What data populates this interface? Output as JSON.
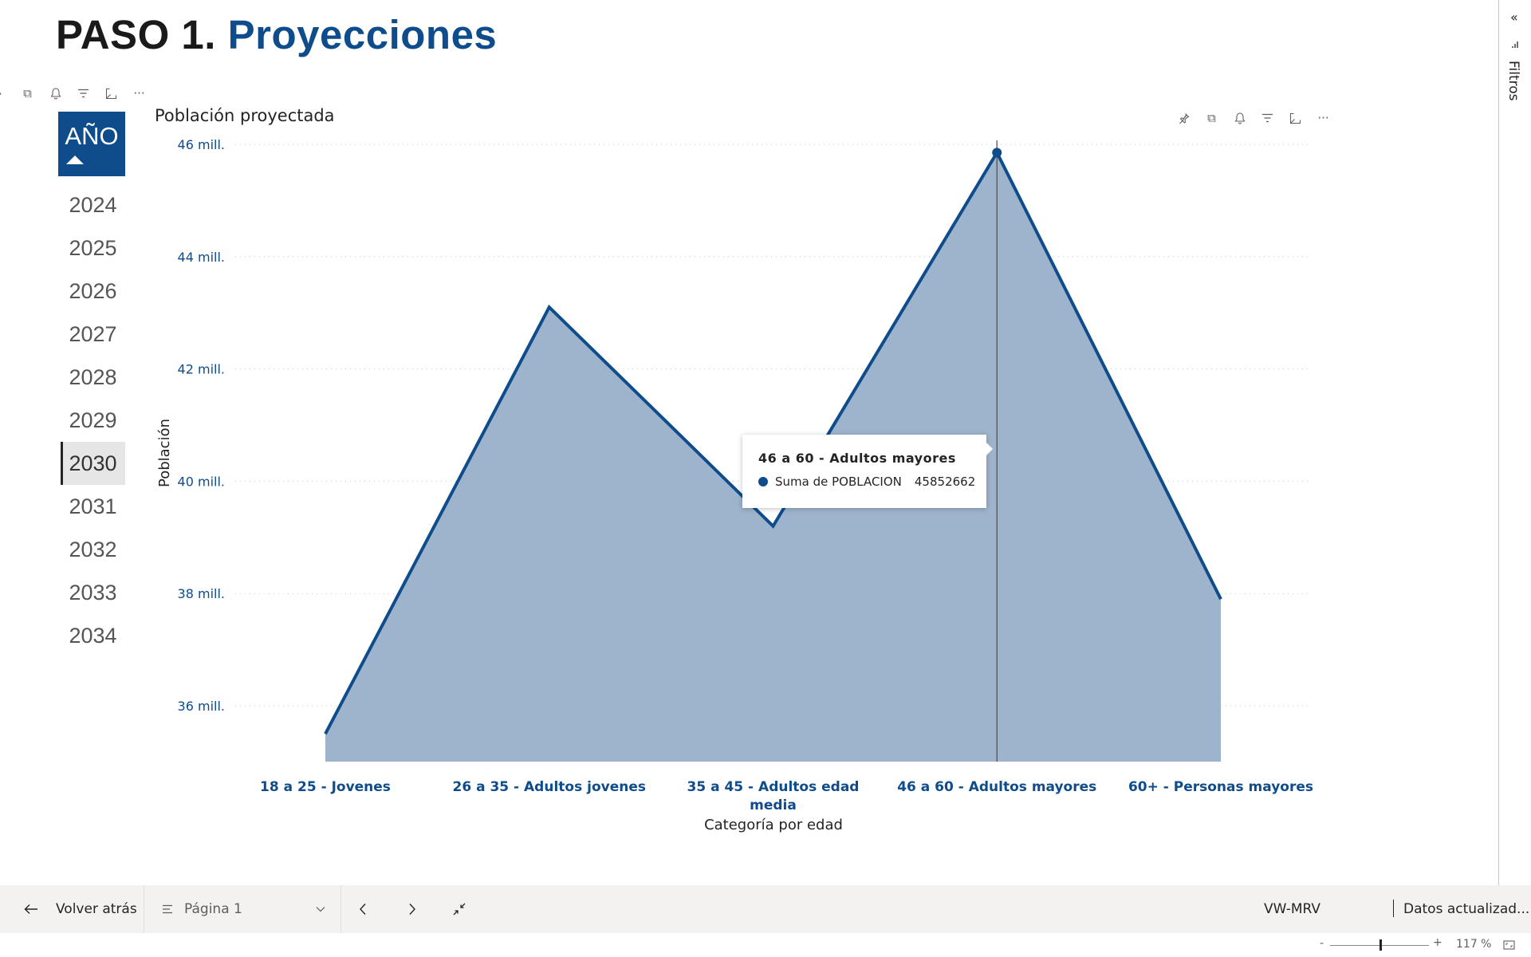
{
  "page_title": {
    "step": "PASO 1.",
    "accent": "Proyecciones"
  },
  "slicer": {
    "header": "AÑO",
    "items": [
      "2024",
      "2025",
      "2026",
      "2027",
      "2028",
      "2029",
      "2030",
      "2031",
      "2032",
      "2033",
      "2034"
    ],
    "selected": "2030"
  },
  "chart_title": "Población proyectada",
  "chart_data": {
    "type": "area",
    "x": [
      "18 a 25 - Jovenes",
      "26 a 35 - Adultos jovenes",
      "35 a 45 - Adultos edad media",
      "46 a 60 - Adultos mayores",
      "60+ - Personas mayores"
    ],
    "x_display": [
      [
        "18 a 25 - Jovenes"
      ],
      [
        "26 a 35 - Adultos jovenes"
      ],
      [
        "35 a 45 - Adultos edad",
        "media"
      ],
      [
        "46 a 60 - Adultos mayores"
      ],
      [
        "60+ - Personas mayores"
      ]
    ],
    "series": [
      {
        "values": [
          35500000,
          43100000,
          39200000,
          45852662,
          37900000
        ]
      }
    ],
    "yticks": [
      36000000,
      38000000,
      40000000,
      42000000,
      44000000,
      46000000
    ],
    "ytick_labels": [
      "36 mill.",
      "38 mill.",
      "40 mill.",
      "42 mill.",
      "44 mill.",
      "46 mill."
    ],
    "ylim": [
      35000000,
      46000000
    ],
    "xlabel": "Categoría por edad",
    "ylabel": "Población",
    "grid": true,
    "line_color": "#0e4c8c",
    "area_color": "#9eb4cc",
    "highlighted_index": 3
  },
  "tooltip": {
    "title": "46 a 60 - Adultos mayores",
    "measure": "Suma de POBLACION",
    "value": "45852662"
  },
  "filters_pane": {
    "label": "Filtros",
    "collapse_icon": "double-chevron-left-icon"
  },
  "bottom_bar": {
    "back_label": "Volver atrás",
    "page_label": "Página 1",
    "workspace": "VW-MRV",
    "data_updated": "Datos actualizad..."
  },
  "status_bar": {
    "zoom_minus": "-",
    "zoom_plus": "+",
    "zoom_level": "117 %"
  },
  "colors": {
    "brand": "#0e4c8c",
    "area": "#9eb4cc",
    "bar_bg": "#f3f2f1"
  }
}
